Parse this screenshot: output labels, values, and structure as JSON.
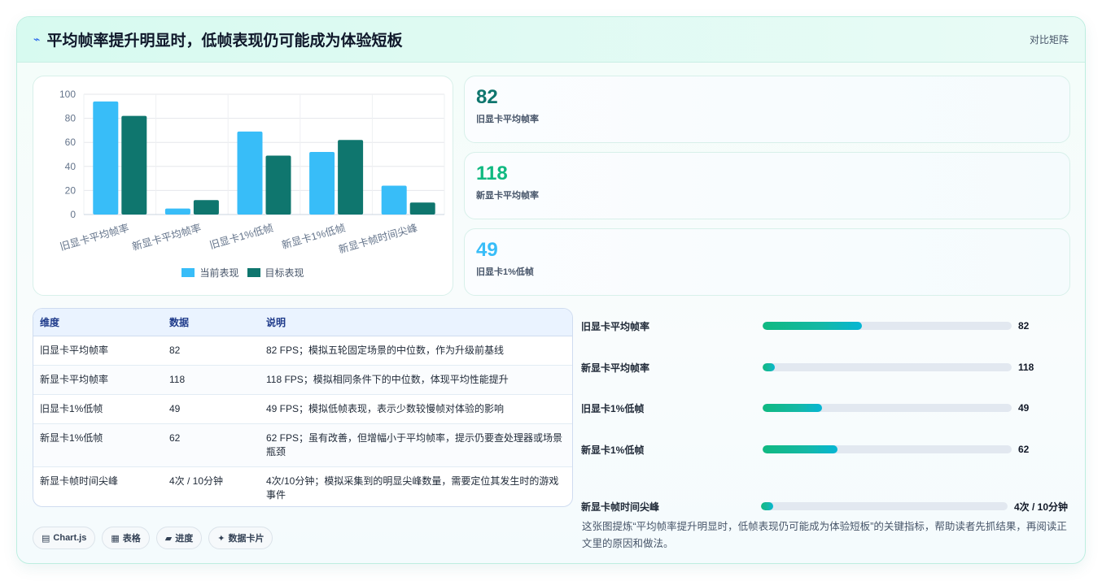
{
  "header": {
    "icon": "lightning-icon",
    "title": "平均帧率提升明显时，低帧表现仍可能成为体验短板",
    "tag": "对比矩阵"
  },
  "chart_data": {
    "type": "bar",
    "categories": [
      "旧显卡平均帧率",
      "新显卡平均帧率",
      "旧显卡1%低帧",
      "新显卡1%低帧",
      "新显卡帧时间尖峰"
    ],
    "series": [
      {
        "name": "当前表现",
        "color": "#38bdf8",
        "values": [
          94,
          5,
          69,
          52,
          24
        ]
      },
      {
        "name": "目标表现",
        "color": "#0f766e",
        "values": [
          82,
          12,
          49,
          62,
          10
        ]
      }
    ],
    "yticks": [
      "0",
      "20",
      "40",
      "60",
      "80",
      "100"
    ],
    "ylim": [
      0,
      100
    ],
    "grid": true,
    "legend_position": "bottom"
  },
  "stats": [
    {
      "value": "82",
      "label": "旧显卡平均帧率",
      "color": "#0f766e"
    },
    {
      "value": "118",
      "label": "新显卡平均帧率",
      "color": "#10b981"
    },
    {
      "value": "49",
      "label": "旧显卡1%低帧",
      "color": "#38bdf8"
    }
  ],
  "table": {
    "headers": [
      "维度",
      "数据",
      "说明"
    ],
    "rows": [
      [
        "旧显卡平均帧率",
        "82",
        "82 FPS；模拟五轮固定场景的中位数，作为升级前基线"
      ],
      [
        "新显卡平均帧率",
        "118",
        "118 FPS；模拟相同条件下的中位数，体现平均性能提升"
      ],
      [
        "旧显卡1%低帧",
        "49",
        "49 FPS；模拟低帧表现，表示少数较慢帧对体验的影响"
      ],
      [
        "新显卡1%低帧",
        "62",
        "62 FPS；虽有改善，但增幅小于平均帧率，提示仍要查处理器或场景瓶颈"
      ],
      [
        "新显卡帧时间尖峰",
        "4次 / 10分钟",
        "4次/10分钟；模拟采集到的明显尖峰数量，需要定位其发生时的游戏事件"
      ]
    ]
  },
  "progress": [
    {
      "label": "旧显卡平均帧率",
      "value": "82",
      "fraction": 0.4
    },
    {
      "label": "新显卡平均帧率",
      "value": "118",
      "fraction": 0.05
    },
    {
      "label": "旧显卡1%低帧",
      "value": "49",
      "fraction": 0.24
    },
    {
      "label": "新显卡1%低帧",
      "value": "62",
      "fraction": 0.3
    },
    {
      "label": "新显卡帧时间尖峰",
      "value": "4次 / 10分钟",
      "fraction": 0.05
    }
  ],
  "chips": [
    {
      "icon": "chart-icon",
      "glyph": "▤",
      "label": "Chart.js"
    },
    {
      "icon": "table-icon",
      "glyph": "▦",
      "label": "表格"
    },
    {
      "icon": "progress-icon",
      "glyph": "▰",
      "label": "进度"
    },
    {
      "icon": "sparkle-icon",
      "glyph": "✦",
      "label": "数据卡片"
    }
  ],
  "summary": "这张图提炼“平均帧率提升明显时，低帧表现仍可能成为体验短板”的关键指标，帮助读者先抓结果，再阅读正文里的原因和做法。"
}
